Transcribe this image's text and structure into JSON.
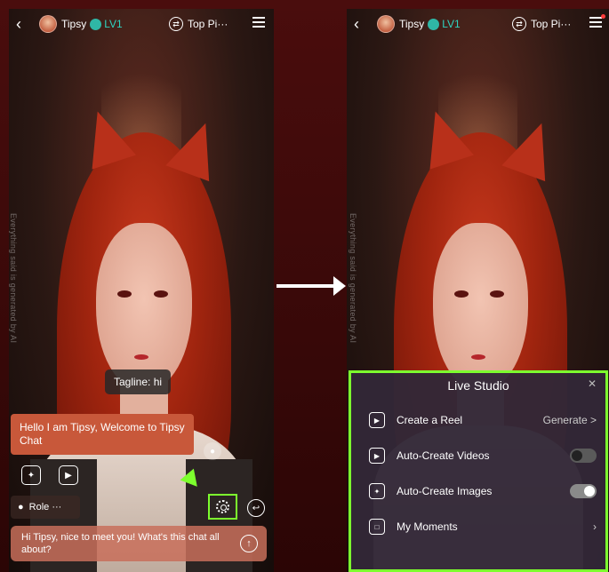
{
  "left": {
    "topbar": {
      "name": "Tipsy",
      "level": "LV1",
      "mode": "Top Pi···"
    },
    "watermark": "Everything said is generated by AI",
    "tagline": "Tagline: hi",
    "greeting": "Hello I am Tipsy, Welcome to Tipsy Chat",
    "role_label": "Role ···",
    "input_text": "Hi Tipsy, nice to meet you! What's this chat all about?"
  },
  "right": {
    "topbar": {
      "name": "Tipsy",
      "level": "LV1",
      "mode": "Top Pi···"
    },
    "watermark": "Everything said is generated by AI",
    "studio": {
      "title": "Live Studio",
      "items": [
        {
          "label": "Create a Reel",
          "action": "Generate >"
        },
        {
          "label": "Auto-Create Videos",
          "toggle": false
        },
        {
          "label": "Auto-Create Images",
          "toggle": true
        },
        {
          "label": "My Moments"
        }
      ]
    }
  },
  "colors": {
    "highlight": "#7dff2e",
    "accent": "#c8583a",
    "level": "#2fd3c0"
  }
}
